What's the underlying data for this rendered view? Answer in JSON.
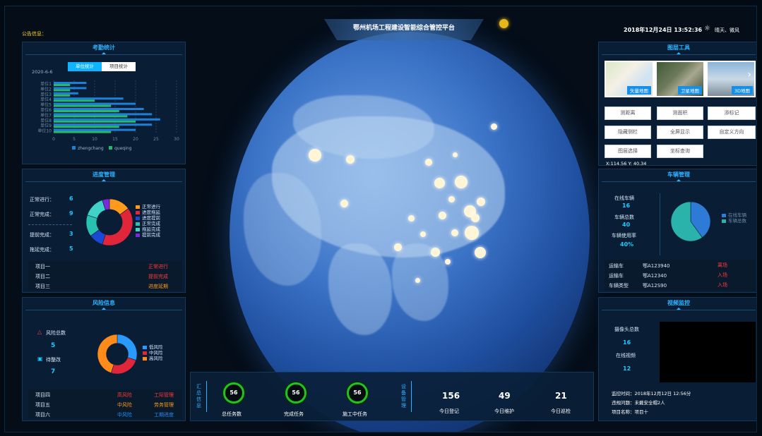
{
  "header": {
    "title": "鄂州机场工程建设智能综合管控平台",
    "notice": "公告信息：",
    "datetime": "2018年12月24日 13:52:36",
    "weather": "晴天、微风"
  },
  "attendance": {
    "title": "考勤统计",
    "tabs": [
      "单位统计",
      "项目统计"
    ],
    "date": "2020-6-6",
    "chart_data": {
      "type": "bar",
      "orientation": "horizontal",
      "categories": [
        "单位1",
        "单位2",
        "单位3",
        "单位4",
        "单位5",
        "单位6",
        "单位7",
        "单位8",
        "单位9",
        "单位10"
      ],
      "series": [
        {
          "name": "zhengchang",
          "values": [
            8,
            8,
            6,
            17,
            20,
            22,
            24,
            26,
            24,
            20
          ],
          "color": "#1e7fd8"
        },
        {
          "name": "queqing",
          "values": [
            4,
            4,
            4,
            10,
            14,
            16,
            18,
            20,
            16,
            14
          ],
          "color": "#27b86a"
        }
      ],
      "xlim": [
        0,
        30
      ],
      "xticks": [
        "0",
        "5",
        "10",
        "15",
        "20",
        "25",
        "30"
      ],
      "grid": true,
      "legend": "bottom"
    }
  },
  "progress": {
    "title": "进度管理",
    "stats": [
      {
        "label": "正常进行：",
        "value": "6"
      },
      {
        "label": "正常完成：",
        "value": "9"
      },
      {
        "label": "提前完成：",
        "value": "3"
      },
      {
        "label": "拖延完成：",
        "value": "5"
      }
    ],
    "chart_data": {
      "type": "pie",
      "style": "donut",
      "labels": [
        "正常进行",
        "进度拖延",
        "进度提前",
        "正常完成",
        "拖延完成",
        "提前完成"
      ],
      "values": [
        15,
        40,
        10,
        15,
        15,
        5
      ],
      "colors": [
        "#ff9a1c",
        "#e2263a",
        "#1c49d4",
        "#27c2b0",
        "#3fd2c8",
        "#7a2ad8"
      ],
      "legend": "right"
    },
    "rows": [
      {
        "name": "项目一",
        "status": "正常进行",
        "cls": "red"
      },
      {
        "name": "项目二",
        "status": "提前完成",
        "cls": "red"
      },
      {
        "name": "项目三",
        "status": "进度延期",
        "cls": "orange"
      }
    ]
  },
  "risk": {
    "title": "风险信息",
    "total_label": "风险总数",
    "total_value": "5",
    "pending_label": "待整改",
    "pending_value": "7",
    "chart_data": {
      "type": "pie",
      "style": "donut",
      "labels": [
        "低风险",
        "中风险",
        "高风险"
      ],
      "values": [
        30,
        25,
        45
      ],
      "colors": [
        "#2a9aff",
        "#e2263a",
        "#ff8c1a"
      ],
      "legend": "right"
    },
    "rows": [
      {
        "name": "项目四",
        "level": "高风险",
        "level_cls": "red",
        "type": "工际管理",
        "type_cls": "red"
      },
      {
        "name": "项目五",
        "level": "中风险",
        "level_cls": "orange",
        "type": "劳务管理",
        "type_cls": "orange"
      },
      {
        "name": "项目六",
        "level": "中风险",
        "level_cls": "blue",
        "type": "工期进度",
        "type_cls": "blue"
      }
    ]
  },
  "layers": {
    "title": "图层工具",
    "maps": [
      "矢量地图",
      "卫星地图",
      "3D地图"
    ],
    "buttons": [
      "测距离",
      "测面积",
      "添标记",
      "隐藏侧栏",
      "全屏显示",
      "自定义方向",
      "图层选择",
      "坐标查询"
    ],
    "coords": "X:114.56   Y:  40.34"
  },
  "vehicles": {
    "title": "车辆管理",
    "online_label": "在线车辆",
    "online_value": "16",
    "total_label": "车辆总数",
    "total_value": "40",
    "rate_label": "车辆使用率",
    "rate_value": "40%",
    "chart_data": {
      "type": "pie",
      "labels": [
        "在线车辆",
        "车辆总数"
      ],
      "values": [
        40,
        60
      ],
      "colors": [
        "#2d7bd6",
        "#29b3aa"
      ],
      "legend": "right"
    },
    "rows": [
      {
        "a": "运输车",
        "b": "鄂A123940",
        "c": "离场"
      },
      {
        "a": "运输车",
        "b": "鄂A12340",
        "c": "入场"
      },
      {
        "a": "车辆类型",
        "b": "鄂A12S90",
        "c": "入场"
      }
    ]
  },
  "video": {
    "title": "视频监控",
    "cams_label": "摄像头总数",
    "cams_value": "16",
    "online_label": "在线视频",
    "online_value": "12",
    "time": "监控时间：2018年12月12日   12:56分",
    "violation": "违规问题：未戴安全帽2人",
    "project": "项目名称：项目十"
  },
  "summary": {
    "label": "汇总信息",
    "tasks": [
      {
        "value": "56",
        "label": "总任务数"
      },
      {
        "value": "56",
        "label": "完成任务"
      },
      {
        "value": "56",
        "label": "施工中任务"
      }
    ],
    "device_label": "设备管理",
    "devices": [
      {
        "value": "156",
        "label": "今日登记"
      },
      {
        "value": "49",
        "label": "今日维护"
      },
      {
        "value": "21",
        "label": "今日巡检"
      }
    ]
  }
}
